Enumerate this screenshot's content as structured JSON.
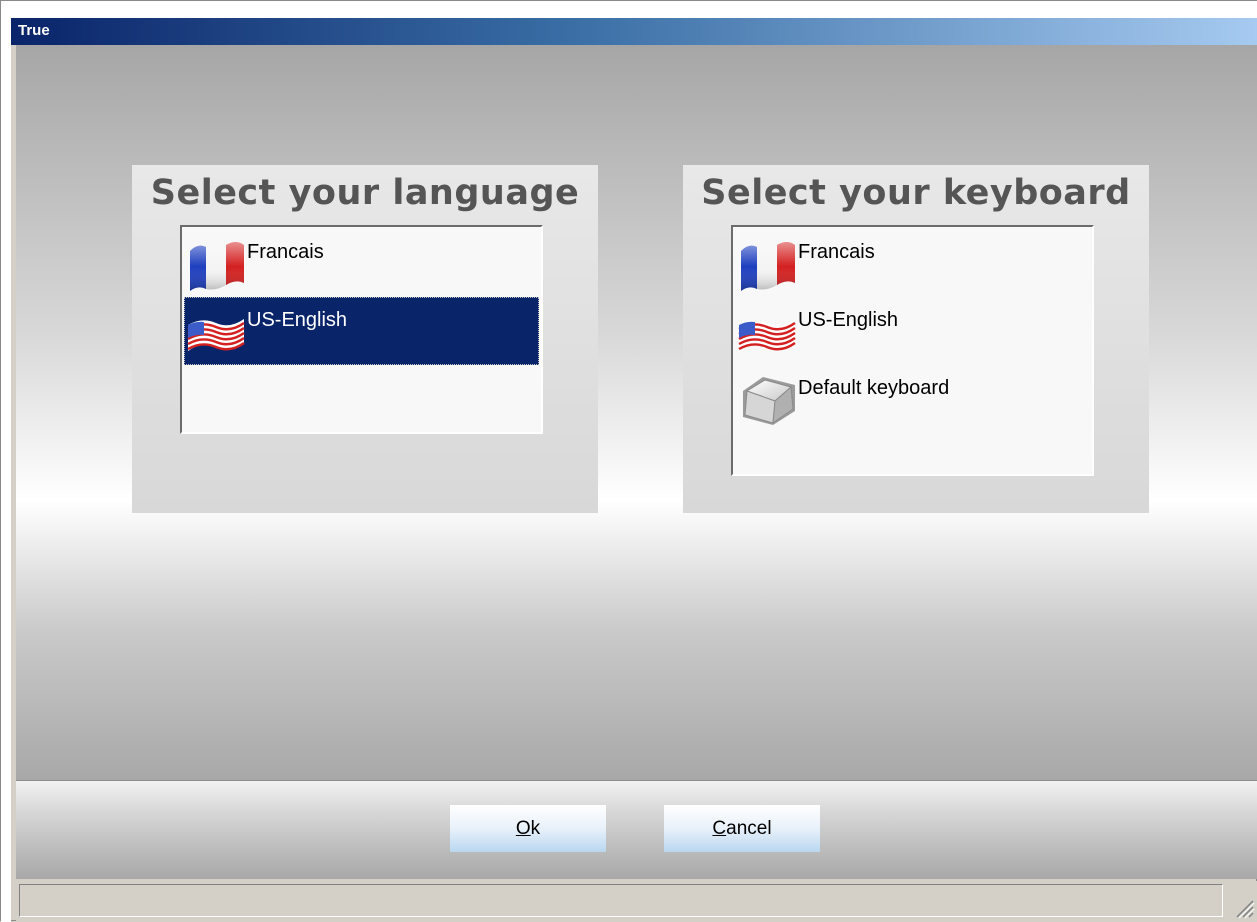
{
  "window": {
    "title": "True"
  },
  "language_panel": {
    "heading": "Select your language",
    "items": [
      {
        "label": "Francais",
        "icon": "france-flag-icon",
        "selected": false
      },
      {
        "label": "US-English",
        "icon": "us-flag-icon",
        "selected": true
      }
    ]
  },
  "keyboard_panel": {
    "heading": "Select your keyboard",
    "items": [
      {
        "label": "Francais",
        "icon": "france-flag-icon",
        "selected": false
      },
      {
        "label": "US-English",
        "icon": "us-flag-icon",
        "selected": false
      },
      {
        "label": "Default keyboard",
        "icon": "keyboard-key-icon",
        "selected": false
      }
    ]
  },
  "buttons": {
    "ok": {
      "mnemonic": "O",
      "rest": "k"
    },
    "cancel": {
      "mnemonic": "C",
      "rest": "ancel"
    }
  },
  "colors": {
    "selection": "#0a246a",
    "title_start": "#0a246a",
    "title_end": "#a6caf0"
  }
}
